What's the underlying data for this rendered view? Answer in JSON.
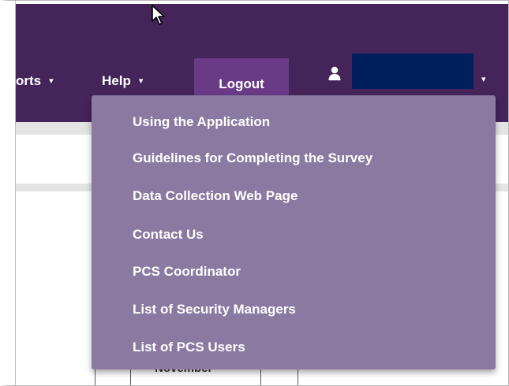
{
  "nav": {
    "reports_label": "orts",
    "reports_caret": "▾",
    "help_label": "Help",
    "help_caret": "▾",
    "logout_label": "Logout",
    "user_caret": "▾"
  },
  "help_menu": {
    "items": [
      {
        "label": "Using the Application"
      },
      {
        "label": "Guidelines for Completing the Survey"
      },
      {
        "label": "Data Collection Web Page"
      },
      {
        "label": "Contact Us"
      },
      {
        "label": "PCS Coordinator"
      },
      {
        "label": "List of Security Managers"
      },
      {
        "label": "List of PCS Users"
      }
    ]
  },
  "table": {
    "visible_cell": "November"
  },
  "colors": {
    "navbar": "#45245a",
    "logout_button": "#693a86",
    "dropdown": "#8a7aa1",
    "user_name_redaction": "#001f5c"
  },
  "icons": {
    "user": "user-icon",
    "cursor": "mouse-pointer-icon"
  }
}
